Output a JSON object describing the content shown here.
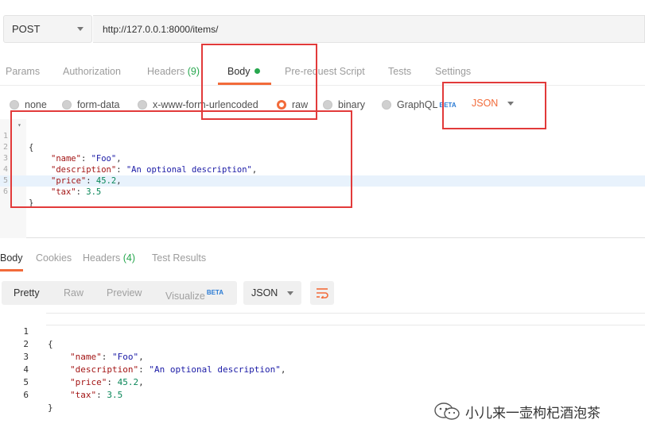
{
  "request": {
    "method": "POST",
    "url": "http://127.0.0.1:8000/items/"
  },
  "request_tabs": [
    {
      "label": "Params"
    },
    {
      "label": "Authorization"
    },
    {
      "label": "Headers",
      "count": "(9)"
    },
    {
      "label": "Body"
    },
    {
      "label": "Pre-request Script"
    },
    {
      "label": "Tests"
    },
    {
      "label": "Settings"
    }
  ],
  "body_types": [
    {
      "label": "none"
    },
    {
      "label": "form-data"
    },
    {
      "label": "x-www-form-urlencoded"
    },
    {
      "label": "raw"
    },
    {
      "label": "binary"
    },
    {
      "label": "GraphQL",
      "badge": "BETA"
    }
  ],
  "raw_language": "JSON",
  "request_body": {
    "line_numbers": [
      "1",
      "2",
      "3",
      "4",
      "5",
      "6"
    ],
    "open": "{",
    "close": "}",
    "fields": [
      {
        "key": "\"name\"",
        "value": "\"Foo\"",
        "sep": ","
      },
      {
        "key": "\"description\"",
        "value": "\"An optional description\"",
        "sep": ","
      },
      {
        "key": "\"price\"",
        "value": "45.2",
        "sep": ","
      },
      {
        "key": "\"tax\"",
        "value": "3.5",
        "sep": ""
      }
    ]
  },
  "response_tabs": [
    {
      "label": "Body"
    },
    {
      "label": "Cookies"
    },
    {
      "label": "Headers",
      "count": "(4)"
    },
    {
      "label": "Test Results"
    }
  ],
  "response_views": [
    {
      "label": "Pretty"
    },
    {
      "label": "Raw"
    },
    {
      "label": "Preview"
    },
    {
      "label": "Visualize",
      "badge": "BETA"
    }
  ],
  "response_format": "JSON",
  "watermark": "小儿来一壶枸杞酒泡茶",
  "colors": {
    "accent": "#f26b3a",
    "green": "#27a74e",
    "annotation_red": "#e23a3a"
  }
}
